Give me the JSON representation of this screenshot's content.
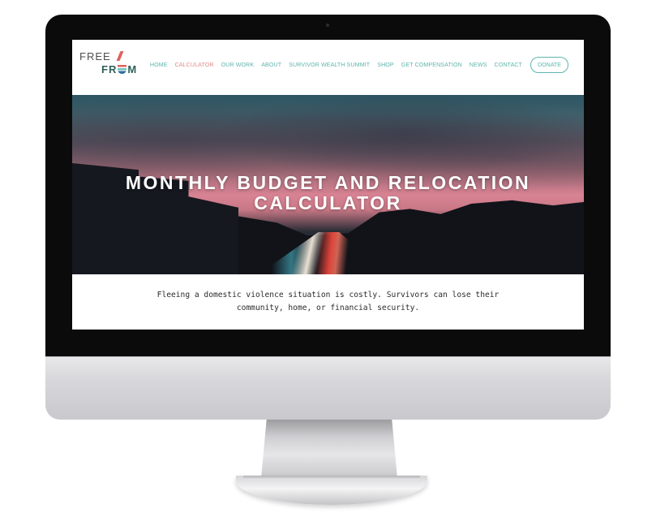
{
  "site": {
    "logo": {
      "line1": "FREE",
      "line2_left": "FR",
      "line2_right": "M"
    },
    "nav": [
      {
        "label": "HOME",
        "active": false
      },
      {
        "label": "CALCULATOR",
        "active": true
      },
      {
        "label": "OUR WORK",
        "active": false
      },
      {
        "label": "ABOUT",
        "active": false
      },
      {
        "label": "SURVIVOR WEALTH SUMMIT",
        "active": false
      },
      {
        "label": "SHOP",
        "active": false
      },
      {
        "label": "GET COMPENSATION",
        "active": false
      },
      {
        "label": "NEWS",
        "active": false
      },
      {
        "label": "CONTACT",
        "active": false
      }
    ],
    "donate_label": "DONATE",
    "hero": {
      "title_line1": "MONTHLY BUDGET AND RELOCATION",
      "title_line2": "CALCULATOR"
    },
    "intro": {
      "line1": "Fleeing a domestic violence situation is costly. Survivors can lose their",
      "line2": "community, home, or financial security."
    }
  },
  "colors": {
    "nav_text": "#5fb5ad",
    "nav_active": "#e08b8a",
    "logo_accent": "#e0625a",
    "logo_dark": "#2f5f5a"
  }
}
